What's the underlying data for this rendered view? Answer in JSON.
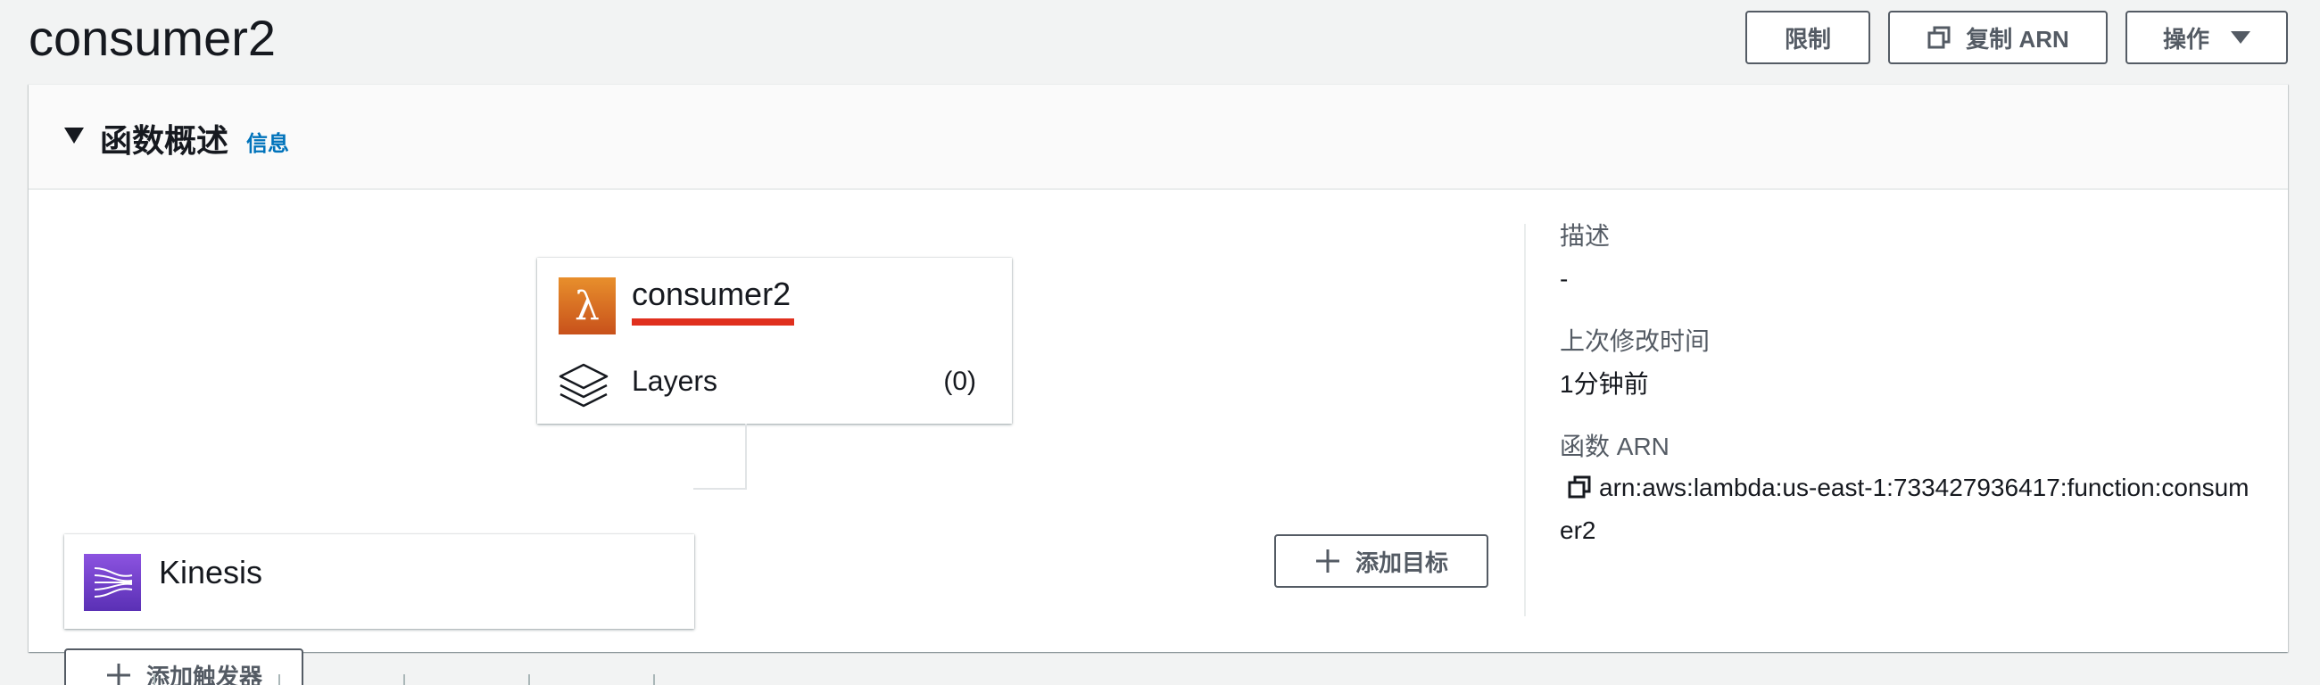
{
  "header": {
    "title": "consumer2",
    "throttle_label": "限制",
    "copy_arn_label": "复制 ARN",
    "actions_label": "操作"
  },
  "overview": {
    "section_title": "函数概述",
    "info_link": "信息"
  },
  "diagram": {
    "function": {
      "name": "consumer2",
      "layers_label": "Layers",
      "layers_count": "(0)",
      "icon": "lambda-icon"
    },
    "trigger": {
      "name": "Kinesis",
      "icon": "kinesis-icon"
    },
    "add_trigger_label": "添加触发器",
    "add_destination_label": "添加目标"
  },
  "details": {
    "description_label": "描述",
    "description_value": "-",
    "last_modified_label": "上次修改时间",
    "last_modified_value": "1分钟前",
    "arn_label": "函数 ARN",
    "arn_value": "arn:aws:lambda:us-east-1:733427936417:function:consumer2"
  },
  "colors": {
    "accent_link": "#0073bb",
    "lambda_orange": "#e07b26",
    "kinesis_purple": "#7545d0",
    "highlight_underline": "#e0301e"
  }
}
